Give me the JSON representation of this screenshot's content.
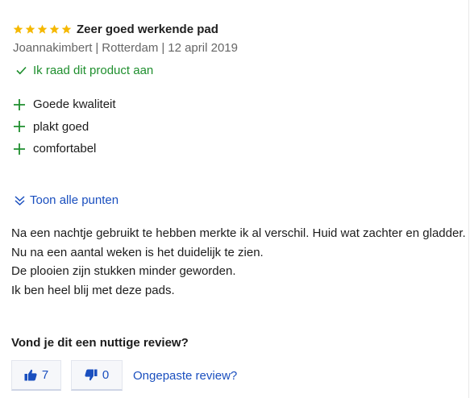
{
  "review": {
    "rating": 5,
    "rating_max": 5,
    "title": "Zeer goed werkende pad",
    "author": "Joannakimbert",
    "location": "Rotterdam",
    "date": "12 april 2019",
    "separator": "|",
    "recommend": "Ik raad dit product aan",
    "pros": [
      "Goede kwaliteit",
      "plakt goed",
      "comfortabel"
    ],
    "show_all": "Toon alle punten",
    "body": [
      "Na een nachtje gebruikt te hebben merkte ik al verschil. Huid wat zachter en gladder.",
      "Nu na een aantal weken is het duidelijk te zien.",
      "De plooien zijn stukken minder geworden.",
      "Ik ben heel blij met deze pads."
    ]
  },
  "helpful": {
    "question": "Vond je dit een nuttige review?",
    "up_count": "7",
    "down_count": "0",
    "report_label": "Ongepaste review?"
  },
  "colors": {
    "star": "#f5b800",
    "positive": "#1f8f2e",
    "link": "#1a4fbf"
  },
  "icons": [
    "star-icon",
    "checkmark-icon",
    "plus-icon",
    "double-chevron-down-icon",
    "thumbs-up-icon",
    "thumbs-down-icon"
  ]
}
